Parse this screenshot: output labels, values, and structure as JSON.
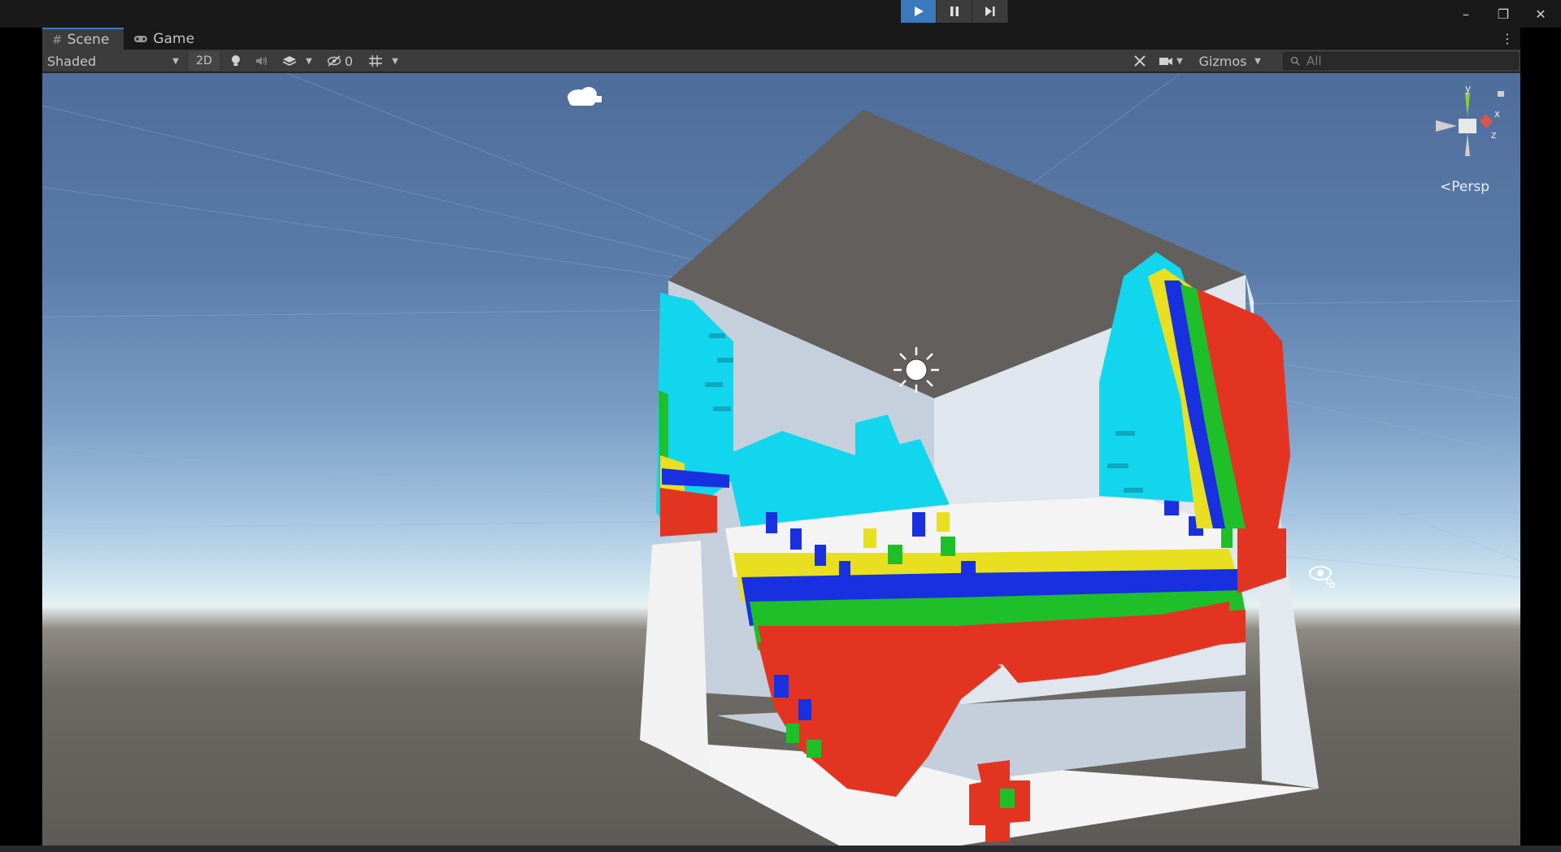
{
  "toolbar_top": {
    "play_icon": "play-icon",
    "pause_icon": "pause-icon",
    "step_icon": "step-icon",
    "window_controls": {
      "minimize": "–",
      "restore": "❐",
      "close": "✕"
    }
  },
  "tabs": [
    {
      "label": "Scene",
      "icon": "#",
      "active": true
    },
    {
      "label": "Game",
      "icon": "🎮",
      "active": false
    }
  ],
  "scene_toolbar": {
    "draw_mode": "Shaded",
    "mode_2d": "2D",
    "hidden_count": "0",
    "gizmos_label": "Gizmos",
    "search_placeholder": "All"
  },
  "orientation_gizmo": {
    "axis_y": "y",
    "axis_x": "x",
    "axis_z": "z",
    "projection": "Persp"
  },
  "colors": {
    "accent": "#3a79bb",
    "voxel_red": "#e33422",
    "voxel_cyan": "#12d6ee",
    "voxel_blue": "#1830e0",
    "voxel_green": "#1fbf2a",
    "voxel_yellow": "#e8df20",
    "voxel_white": "#f4f4f4"
  }
}
